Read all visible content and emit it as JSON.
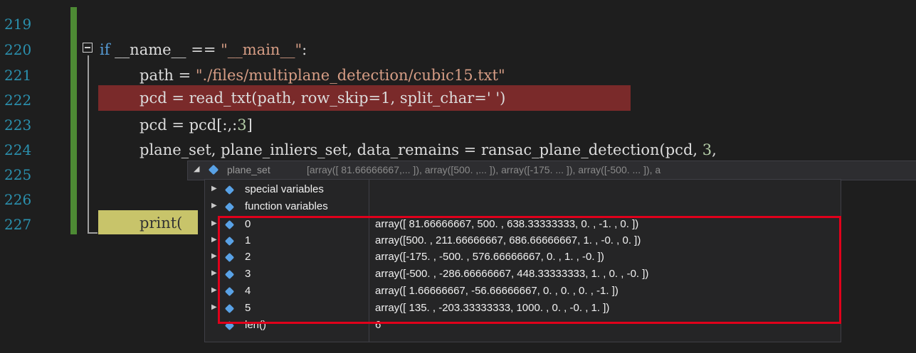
{
  "line_numbers": [
    "219",
    "220",
    "221",
    "222",
    "223",
    "224",
    "225",
    "226",
    "227"
  ],
  "code": {
    "l220_kw": "if",
    "l220_rest": " __name__ == ",
    "l220_str": "\"__main__\"",
    "l220_end": ":",
    "l221_pre": "path = ",
    "l221_str": "\"./files/multiplane_detection/cubic15.txt\"",
    "l222": "pcd = read_txt(path, row_skip=1, split_char=' ')",
    "l223_pre": "pcd = pcd[:,:",
    "l223_num": "3",
    "l223_end": "]",
    "l224_pre": "plane_set, plane_inliers_set, data_remains = ransac_plane_detection(pcd, ",
    "l224_num": "3",
    "l224_end": ",",
    "l227": "print("
  },
  "tooltip": {
    "expand_glyph": "◢",
    "name": "plane_set",
    "value": "[array([ 81.66666667,...        ]), array([500.        ,...        ]), array([-175.        ...        ]), array([-500.        ...        ]), a"
  },
  "rows": [
    {
      "name": "special variables",
      "value": ""
    },
    {
      "name": "function variables",
      "value": ""
    },
    {
      "name": "0",
      "value": "array([ 81.66666667, 500.        , 638.33333333,   0.        ,    -1.        ,    0.        ])"
    },
    {
      "name": "1",
      "value": "array([500.        , 211.66666667, 686.66666667,   1.        ,    -0.        ,    0.        ])"
    },
    {
      "name": "2",
      "value": "array([-175.        , -500.        , 576.66666667,   0.        ,     1.        ,   -0.        ])"
    },
    {
      "name": "3",
      "value": "array([-500.        , -286.66666667, 448.33333333,   1.        ,     0.        ,   -0.        ])"
    },
    {
      "name": "4",
      "value": "array([  1.66666667, -56.66666667,   0.        ,   0.        ,     0.        ,   -1.        ])"
    },
    {
      "name": "5",
      "value": "array([ 135.        , -203.33333333, 1000.        ,   0.        ,    -0.        ,    1.        ])"
    },
    {
      "name": "len()",
      "value": "6"
    }
  ],
  "colors": {
    "editor_bg": "#1e1e1e",
    "breakpoint_line": "#7a2a2a",
    "current_line": "#c8c46a",
    "selection_box": "#e0001b",
    "line_number": "#2b91af",
    "keyword": "#569cd6",
    "string": "#d69d85"
  }
}
